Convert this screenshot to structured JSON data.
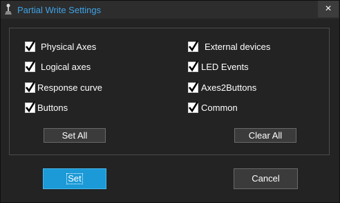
{
  "window": {
    "title": "Partial Write Settings",
    "close_label": "×"
  },
  "checkboxes": [
    {
      "label": "Physical Axes",
      "checked": true
    },
    {
      "label": "Logical axes",
      "checked": true
    },
    {
      "label": "Response curve",
      "checked": true
    },
    {
      "label": "Buttons",
      "checked": true
    },
    {
      "label": "External devices",
      "checked": true
    },
    {
      "label": "LED Events",
      "checked": true
    },
    {
      "label": "Axes2Buttons",
      "checked": true
    },
    {
      "label": "Common",
      "checked": true
    }
  ],
  "panel_buttons": {
    "set_all": "Set All",
    "clear_all": "Clear All"
  },
  "footer_buttons": {
    "set": "Set",
    "cancel": "Cancel"
  },
  "colors": {
    "accent": "#1b9ad7",
    "title_text": "#3fa3e6",
    "background": "#232323"
  }
}
